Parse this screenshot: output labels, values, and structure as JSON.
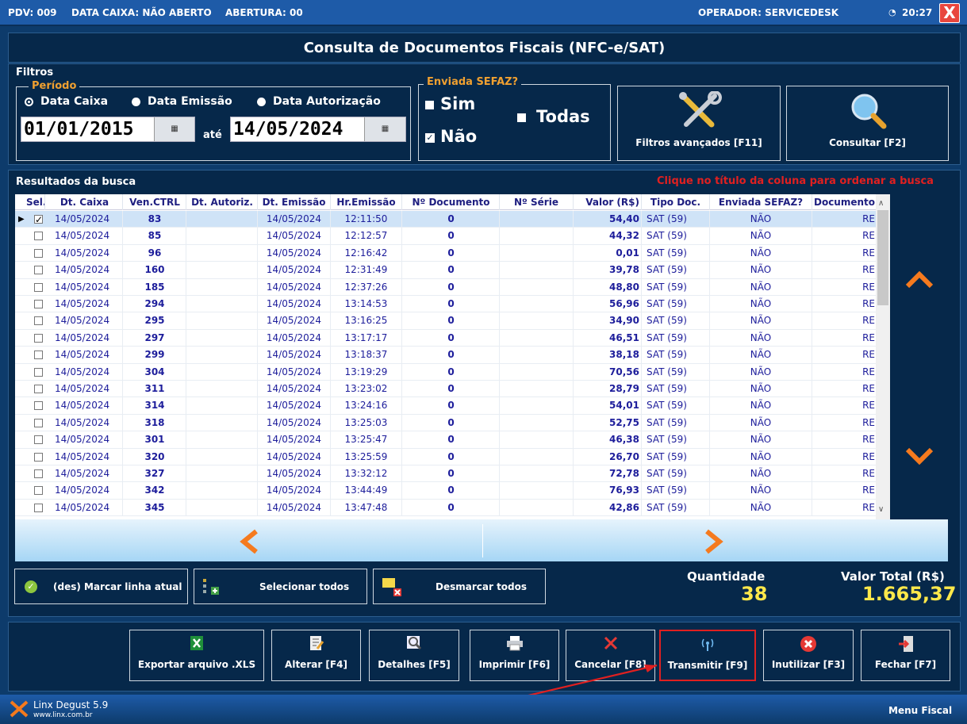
{
  "topbar": {
    "pdv": "PDV: 009",
    "data_caixa": "DATA CAIXA: NÃO ABERTO",
    "abertura": "ABERTURA: 00",
    "operador": "OPERADOR: SERVICEDESK",
    "time": "20:27",
    "close_label": "X"
  },
  "title": "Consulta de Documentos Fiscais (NFC-e/SAT)",
  "filters": {
    "label": "Filtros",
    "periodo_label": "Período",
    "radios": [
      "Data Caixa",
      "Data Emissão",
      "Data Autorização"
    ],
    "date_from": "01/01/2015",
    "ate": "até",
    "date_to": "14/05/2024",
    "sefaz_label": "Enviada SEFAZ?",
    "sim": "Sim",
    "nao": "Não",
    "todas": "Todas",
    "btn_filtros": "Filtros avançados [F11]",
    "btn_consultar": "Consultar [F2]"
  },
  "results": {
    "label": "Resultados da busca",
    "hint": "Clique no título da coluna para ordenar a busca",
    "columns": [
      "Sel.",
      "Dt. Caixa",
      "Ven.CTRL",
      "Dt. Autoriz.",
      "Dt. Emissão",
      "Hr.Emissão",
      "Nº Documento",
      "Nº Série",
      "Valor (R$)",
      "Tipo Doc.",
      "Enviada SEFAZ?",
      "Documento"
    ],
    "rows": [
      [
        "14/05/2024",
        "83",
        "",
        "14/05/2024",
        "12:11:50",
        "0",
        "",
        "54,40",
        "SAT (59)",
        "NÃO",
        "RE"
      ],
      [
        "14/05/2024",
        "85",
        "",
        "14/05/2024",
        "12:12:57",
        "0",
        "",
        "44,32",
        "SAT (59)",
        "NÃO",
        "RE"
      ],
      [
        "14/05/2024",
        "96",
        "",
        "14/05/2024",
        "12:16:42",
        "0",
        "",
        "0,01",
        "SAT (59)",
        "NÃO",
        "RE"
      ],
      [
        "14/05/2024",
        "160",
        "",
        "14/05/2024",
        "12:31:49",
        "0",
        "",
        "39,78",
        "SAT (59)",
        "NÃO",
        "RE"
      ],
      [
        "14/05/2024",
        "185",
        "",
        "14/05/2024",
        "12:37:26",
        "0",
        "",
        "48,80",
        "SAT (59)",
        "NÃO",
        "RE"
      ],
      [
        "14/05/2024",
        "294",
        "",
        "14/05/2024",
        "13:14:53",
        "0",
        "",
        "56,96",
        "SAT (59)",
        "NÃO",
        "RE"
      ],
      [
        "14/05/2024",
        "295",
        "",
        "14/05/2024",
        "13:16:25",
        "0",
        "",
        "34,90",
        "SAT (59)",
        "NÃO",
        "RE"
      ],
      [
        "14/05/2024",
        "297",
        "",
        "14/05/2024",
        "13:17:17",
        "0",
        "",
        "46,51",
        "SAT (59)",
        "NÃO",
        "RE"
      ],
      [
        "14/05/2024",
        "299",
        "",
        "14/05/2024",
        "13:18:37",
        "0",
        "",
        "38,18",
        "SAT (59)",
        "NÃO",
        "RE"
      ],
      [
        "14/05/2024",
        "304",
        "",
        "14/05/2024",
        "13:19:29",
        "0",
        "",
        "70,56",
        "SAT (59)",
        "NÃO",
        "RE"
      ],
      [
        "14/05/2024",
        "311",
        "",
        "14/05/2024",
        "13:23:02",
        "0",
        "",
        "28,79",
        "SAT (59)",
        "NÃO",
        "RE"
      ],
      [
        "14/05/2024",
        "314",
        "",
        "14/05/2024",
        "13:24:16",
        "0",
        "",
        "54,01",
        "SAT (59)",
        "NÃO",
        "RE"
      ],
      [
        "14/05/2024",
        "318",
        "",
        "14/05/2024",
        "13:25:03",
        "0",
        "",
        "52,75",
        "SAT (59)",
        "NÃO",
        "RE"
      ],
      [
        "14/05/2024",
        "301",
        "",
        "14/05/2024",
        "13:25:47",
        "0",
        "",
        "46,38",
        "SAT (59)",
        "NÃO",
        "RE"
      ],
      [
        "14/05/2024",
        "320",
        "",
        "14/05/2024",
        "13:25:59",
        "0",
        "",
        "26,70",
        "SAT (59)",
        "NÃO",
        "RE"
      ],
      [
        "14/05/2024",
        "327",
        "",
        "14/05/2024",
        "13:32:12",
        "0",
        "",
        "72,78",
        "SAT (59)",
        "NÃO",
        "RE"
      ],
      [
        "14/05/2024",
        "342",
        "",
        "14/05/2024",
        "13:44:49",
        "0",
        "",
        "76,93",
        "SAT (59)",
        "NÃO",
        "RE"
      ],
      [
        "14/05/2024",
        "345",
        "",
        "14/05/2024",
        "13:47:48",
        "0",
        "",
        "42,86",
        "SAT (59)",
        "NÃO",
        "RE"
      ]
    ],
    "selected_row": 0,
    "btn_marcar": "(des) Marcar linha atual",
    "btn_sel_todos": "Selecionar todos",
    "btn_desmarcar": "Desmarcar todos",
    "quantidade_label": "Quantidade",
    "quantidade": "38",
    "valor_total_label": "Valor Total (R$)",
    "valor_total": "1.665,37"
  },
  "actions": [
    "Exportar arquivo .XLS",
    "Alterar [F4]",
    "Detalhes [F5]",
    "Imprimir [F6]",
    "Cancelar [F8]",
    "Transmitir [F9]",
    "Inutilizar [F3]",
    "Fechar [F7]"
  ],
  "footer": {
    "brand": "Linx Degust 5.9",
    "url": "www.linx.com.br",
    "menu": "Menu Fiscal"
  },
  "colors": {
    "bg": "#0d3b6b",
    "panel": "#06284a",
    "accent": "#f0a030",
    "highlight": "#e02020",
    "value_yellow": "#ffe84a"
  }
}
